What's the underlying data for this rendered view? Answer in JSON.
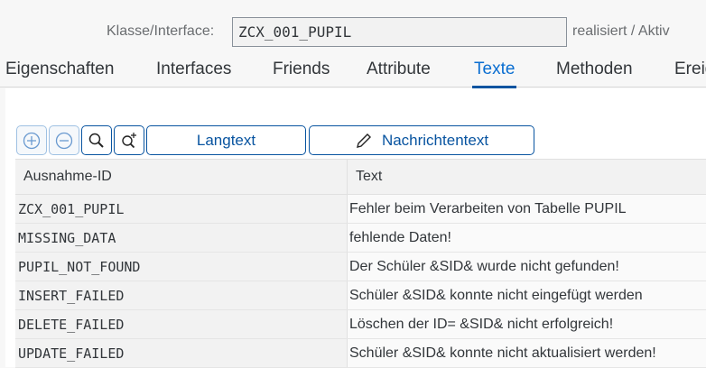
{
  "header": {
    "label": "Klasse/Interface:",
    "value": "ZCX_001_PUPIL",
    "status": "realisiert / Aktiv"
  },
  "tabs": [
    "Eigenschaften",
    "Interfaces",
    "Friends",
    "Attribute",
    "Texte",
    "Methoden",
    "Ereig"
  ],
  "toolbar": {
    "langtext": "Langtext",
    "nachrichtentext": "Nachrichtentext"
  },
  "table": {
    "columns": [
      "Ausnahme-ID",
      "Text"
    ],
    "rows": [
      [
        "ZCX_001_PUPIL",
        "Fehler beim Verarbeiten von Tabelle PUPIL"
      ],
      [
        "MISSING_DATA",
        "fehlende Daten!"
      ],
      [
        "PUPIL_NOT_FOUND",
        "Der Schüler &SID& wurde nicht gefunden!"
      ],
      [
        "INSERT_FAILED",
        "Schüler &SID& konnte nicht eingefügt werden"
      ],
      [
        "DELETE_FAILED",
        "Löschen der ID= &SID& nicht erfolgreich!"
      ],
      [
        "UPDATE_FAILED",
        "Schüler &SID& konnte nicht aktualisiert werden!"
      ]
    ]
  }
}
